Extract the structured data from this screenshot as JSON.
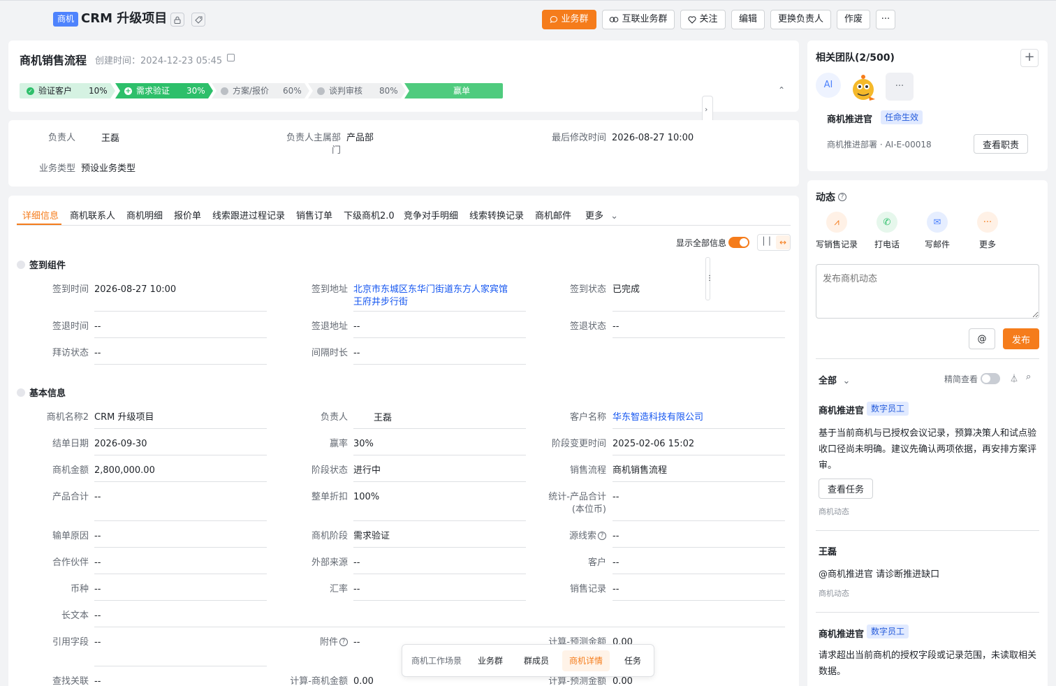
{
  "header": {
    "obj_tag": "商机",
    "title": "CRM 升级项目",
    "buttons": {
      "biz_group": "业务群",
      "linked_group": "互联业务群",
      "follow": "关注",
      "edit": "编辑",
      "change_owner": "更换负责人",
      "void": "作废",
      "more": "···"
    }
  },
  "process": {
    "title": "商机销售流程",
    "created_label": "创建时间：",
    "created_value": "2024-12-23 05:45",
    "stages": [
      {
        "name": "验证客户",
        "pct": "10%"
      },
      {
        "name": "需求验证",
        "pct": "30%"
      },
      {
        "name": "方案/报价",
        "pct": "60%"
      },
      {
        "name": "谈判审核",
        "pct": "80%"
      },
      {
        "name": "赢单",
        "pct": ""
      }
    ]
  },
  "summary": {
    "owner_label": "负责人",
    "owner_value": "王磊",
    "dept_label": "负责人主属部门",
    "dept_value": "产品部",
    "modified_label": "最后修改时间",
    "modified_value": "2026-08-27 10:00",
    "biztype_label": "业务类型",
    "biztype_value": "预设业务类型"
  },
  "tabs": [
    "详细信息",
    "商机联系人",
    "商机明细",
    "报价单",
    "线索跟进过程记录",
    "销售订单",
    "下级商机2.0",
    "竞争对手明细",
    "线索转换记录",
    "商机邮件",
    "更多"
  ],
  "toolbar": {
    "show_all": "显示全部信息"
  },
  "checkin": {
    "title": "签到组件",
    "fields": [
      {
        "label": "签到时间",
        "value": "2026-08-27 10:00"
      },
      {
        "label": "签到地址",
        "value": "北京市东城区东华门街道东方人家宾馆王府井步行街"
      },
      {
        "label": "签到状态",
        "value": "已完成"
      },
      {
        "label": "签退时间",
        "value": "--"
      },
      {
        "label": "签退地址",
        "value": "--"
      },
      {
        "label": "签退状态",
        "value": "--"
      },
      {
        "label": "拜访状态",
        "value": "--"
      },
      {
        "label": "间隔时长",
        "value": "--"
      }
    ]
  },
  "basic": {
    "title": "基本信息",
    "fields": [
      {
        "label": "商机名称2",
        "value": "CRM 升级项目"
      },
      {
        "label": "负责人",
        "value": "王磊"
      },
      {
        "label": "客户名称",
        "value": "华东智造科技有限公司"
      },
      {
        "label": "结单日期",
        "value": "2026-09-30"
      },
      {
        "label": "赢率",
        "value": "30%"
      },
      {
        "label": "阶段变更时间",
        "value": "2025-02-06 15:02"
      },
      {
        "label": "商机金额",
        "value": "2,800,000.00"
      },
      {
        "label": "阶段状态",
        "value": "进行中"
      },
      {
        "label": "销售流程",
        "value": "商机销售流程"
      },
      {
        "label": "产品合计",
        "value": "--"
      },
      {
        "label": "整单折扣",
        "value": "100%"
      },
      {
        "label": "统计-产品合计(本位币)",
        "value": "--"
      },
      {
        "label": "输单原因",
        "value": "--"
      },
      {
        "label": "商机阶段",
        "value": "需求验证"
      },
      {
        "label": "源线索",
        "value": "--"
      },
      {
        "label": "合作伙伴",
        "value": "--"
      },
      {
        "label": "外部来源",
        "value": "--"
      },
      {
        "label": "客户",
        "value": "--"
      },
      {
        "label": "币种",
        "value": "--"
      },
      {
        "label": "汇率",
        "value": "--"
      },
      {
        "label": "销售记录",
        "value": "--"
      },
      {
        "label": "长文本",
        "value": "--"
      },
      {
        "label": "引用字段",
        "value": "--"
      },
      {
        "label": "附件",
        "value": "--"
      },
      {
        "label": "计算-预测金额",
        "value": "0.00"
      },
      {
        "label": "查找关联",
        "value": "--"
      },
      {
        "label": "计算-商机金额",
        "value": "0.00"
      },
      {
        "label": "计算-预测金额",
        "value": "0.00"
      }
    ]
  },
  "team": {
    "title": "相关团队(2/500)",
    "ai_avatar": "AI",
    "more": "···",
    "member_name": "商机推进官",
    "member_badge": "任命生效",
    "member_sub": "商机推进部署 · AI-E-00018",
    "duty_button": "查看职责"
  },
  "activity": {
    "title": "动态",
    "actions": [
      "写销售记录",
      "打电话",
      "写邮件",
      "更多"
    ],
    "placeholder": "发布商机动态",
    "at": "@",
    "publish": "发布",
    "filter": "全部",
    "simple_view": "精简查看",
    "feed": [
      {
        "author": "商机推进官",
        "badge": "数字员工",
        "text": "基于当前商机与已授权会议记录，预算决策人和试点验收口径尚未明确。建议先确认两项依据，再安排方案评审。",
        "button": "查看任务",
        "source": "商机动态"
      },
      {
        "author": "王磊",
        "text": "@商机推进官 请诊断推进缺口",
        "source": "商机动态"
      },
      {
        "author": "商机推进官",
        "badge": "数字员工",
        "text": "请求超出当前商机的授权字段或记录范围，未读取相关数据。"
      }
    ]
  },
  "floatbar": [
    "商机工作场景",
    "业务群",
    "群成员",
    "商机详情",
    "任务"
  ],
  "colors": {
    "accent": "#f57c1b",
    "stage_done": "#2dbf6a",
    "stage_win": "#4fcb7e",
    "link": "#1456f0"
  }
}
